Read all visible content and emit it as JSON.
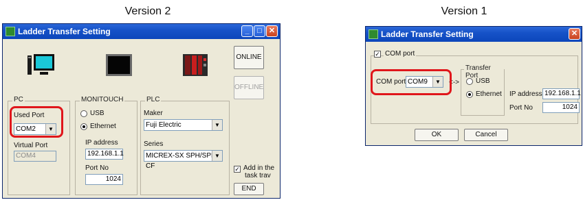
{
  "captions": {
    "left": "Version 2",
    "right": "Version 1"
  },
  "v2": {
    "title": "Ladder Transfer Setting",
    "online": "ONLINE",
    "offline": "OFFLINE",
    "pc": {
      "group": "PC",
      "used_port_label": "Used Port",
      "used_port_value": "COM2",
      "virtual_port_label": "Virtual Port",
      "virtual_port_value": "COM4"
    },
    "monitouch": {
      "group": "MONITOUCH",
      "usb": "USB",
      "ethernet": "Ethernet",
      "selected": "Ethernet",
      "ip_label": "IP address",
      "ip_value": "192.168.1.1",
      "port_label": "Port No",
      "port_value": "1024"
    },
    "plc": {
      "group": "PLC",
      "maker_label": "Maker",
      "maker_value": "Fuji Electric",
      "series_label": "Series",
      "series_value": "MICREX-SX SPH/SPB CF"
    },
    "taskbar": {
      "label_line1": "Add in the",
      "label_line2": "task trav",
      "checked": true
    },
    "end": "END"
  },
  "v1": {
    "title": "Ladder Transfer Setting",
    "com_port_group": "COM port",
    "com_port_checked": true,
    "com_port_label": "COM port",
    "com_port_value": "COM9",
    "arrow": "<->",
    "transfer": {
      "group": "Transfer Port",
      "usb": "USB",
      "ethernet": "Ethernet",
      "selected": "Ethernet"
    },
    "ip_label": "IP address",
    "ip_value": "192.168.1.1",
    "port_label": "Port No",
    "port_value": "1024",
    "ok": "OK",
    "cancel": "Cancel"
  },
  "colors": {
    "highlight": "#e0161b",
    "titlebar": "#1652c8",
    "dialog_bg": "#ece9d8"
  }
}
